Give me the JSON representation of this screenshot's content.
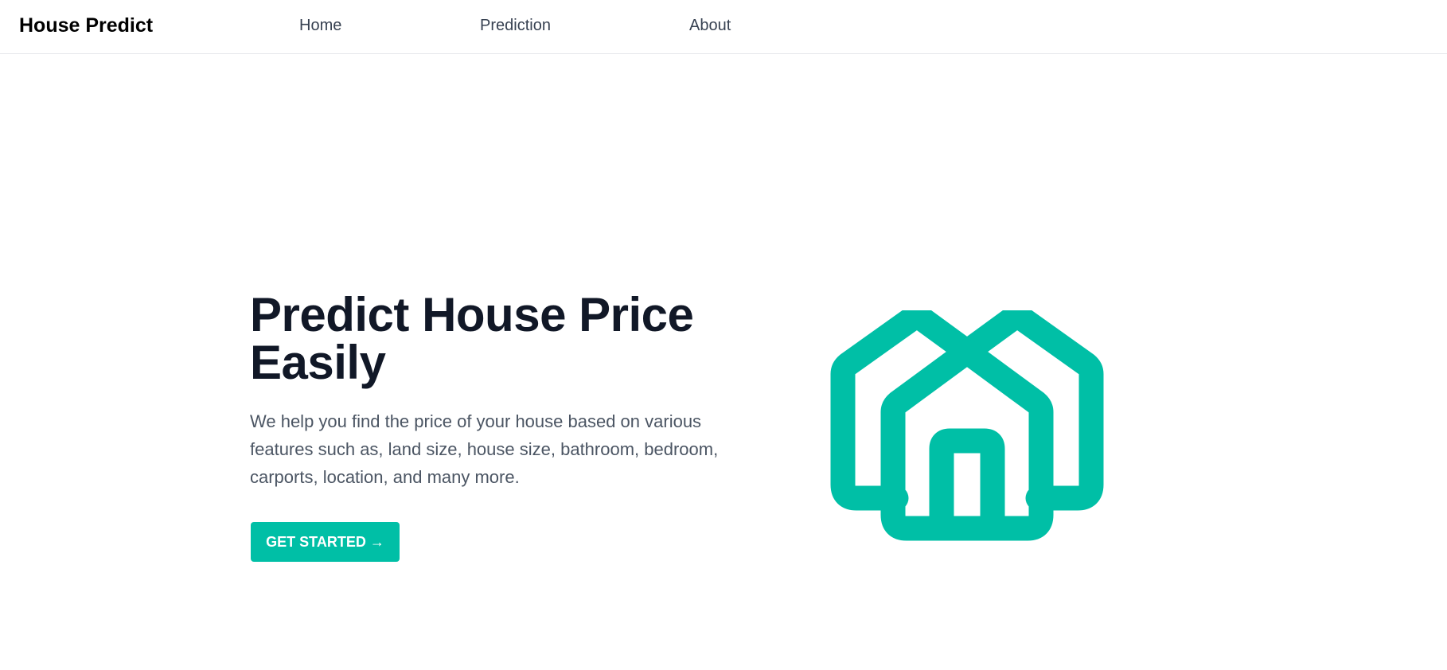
{
  "nav": {
    "brand": "House Predict",
    "links": [
      {
        "label": "Home"
      },
      {
        "label": "Prediction"
      },
      {
        "label": "About"
      }
    ]
  },
  "hero": {
    "title": "Predict House Price Easily",
    "description": "We help you find the price of your house based on various features such as, land size, house size, bathroom, bedroom, carports, location, and many more.",
    "cta_label": "GET STARTED →",
    "illustration_icon": "houses-icon"
  },
  "colors": {
    "accent": "#00bfa6",
    "heading": "#111827",
    "body_text": "#4b5563",
    "nav_text": "#374151"
  }
}
